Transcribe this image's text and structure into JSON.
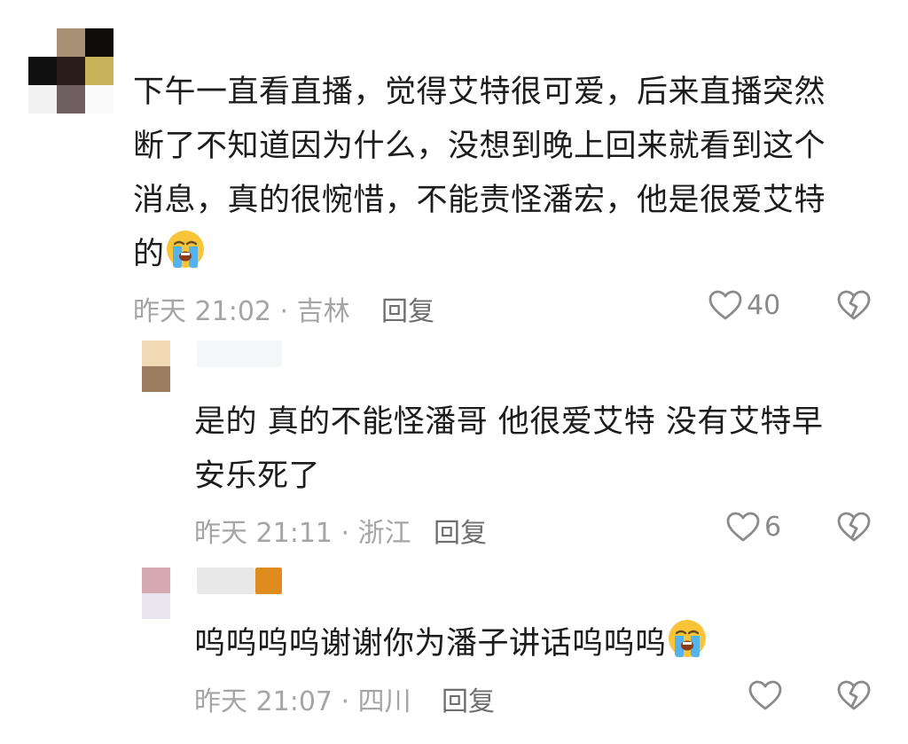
{
  "comments": [
    {
      "lines": [
        "下午一直看直播，觉得艾特很可爱，后来直播突然",
        "断了不知道因为什么，没想到晚上回来就看到这个",
        "消息，真的很惋惜，不能责怪潘宏，他是很爱艾特",
        "的"
      ],
      "emoji": "loudly-crying-face",
      "meta": "昨天 21:02 · 吉林",
      "reply_label": "回复",
      "likes": "40"
    },
    {
      "lines": [
        "是的 真的不能怪潘哥 他很爱艾特 没有艾特早",
        "安乐死了"
      ],
      "meta": "昨天 21:11 · 浙江",
      "reply_label": "回复",
      "likes": "6"
    },
    {
      "lines": [
        "呜呜呜呜谢谢你为潘子讲话呜呜呜"
      ],
      "emoji": "loudly-crying-face",
      "meta": "昨天 21:07 · 四川",
      "reply_label": "回复",
      "likes": ""
    }
  ],
  "colors": {
    "text": "#1c1c1c",
    "meta": "#a5a5a5",
    "reply": "#6e6e6e",
    "icon": "#8a8a8a"
  }
}
